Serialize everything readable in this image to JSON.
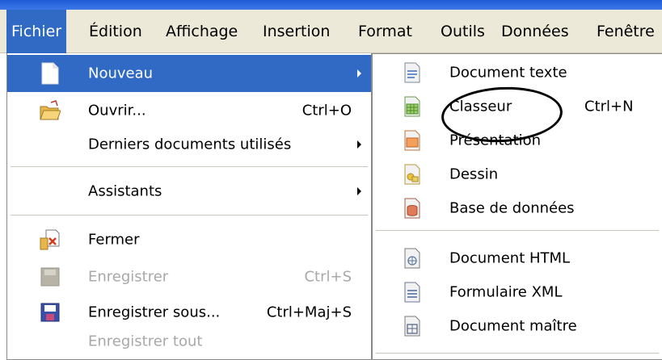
{
  "menubar": {
    "items": [
      "Fichier",
      "Édition",
      "Affichage",
      "Insertion",
      "Format",
      "Outils",
      "Données",
      "Fenêtre"
    ]
  },
  "fichier_menu": {
    "items": [
      {
        "label": "Nouveau",
        "shortcut": "",
        "icon": "new-document-icon"
      },
      {
        "label": "Ouvrir...",
        "shortcut": "Ctrl+O",
        "icon": "open-folder-icon"
      },
      {
        "label": "Derniers documents utilisés",
        "shortcut": "",
        "icon": ""
      },
      {
        "label": "Assistants",
        "shortcut": "",
        "icon": ""
      },
      {
        "label": "Fermer",
        "shortcut": "",
        "icon": "close-document-icon"
      },
      {
        "label": "Enregistrer",
        "shortcut": "Ctrl+S",
        "icon": "save-icon"
      },
      {
        "label": "Enregistrer sous...",
        "shortcut": "Ctrl+Maj+S",
        "icon": "save-as-icon"
      },
      {
        "label": "Enregistrer tout",
        "shortcut": "",
        "icon": ""
      }
    ]
  },
  "nouveau_submenu": {
    "items": [
      {
        "label": "Document texte",
        "shortcut": "",
        "icon": "text-document-icon"
      },
      {
        "label": "Classeur",
        "shortcut": "Ctrl+N",
        "icon": "spreadsheet-icon"
      },
      {
        "label": "Présentation",
        "shortcut": "",
        "icon": "presentation-icon"
      },
      {
        "label": "Dessin",
        "shortcut": "",
        "icon": "drawing-icon"
      },
      {
        "label": "Base de données",
        "shortcut": "",
        "icon": "database-icon"
      },
      {
        "label": "Document HTML",
        "shortcut": "",
        "icon": "html-document-icon"
      },
      {
        "label": "Formulaire XML",
        "shortcut": "",
        "icon": "xml-form-icon"
      },
      {
        "label": "Document maître",
        "shortcut": "",
        "icon": "master-document-icon"
      }
    ]
  },
  "colors": {
    "highlight": "#316ac5",
    "menubar_bg": "#ece9d8",
    "disabled_text": "#a8a8a8",
    "annotation_circle": "#000000"
  }
}
